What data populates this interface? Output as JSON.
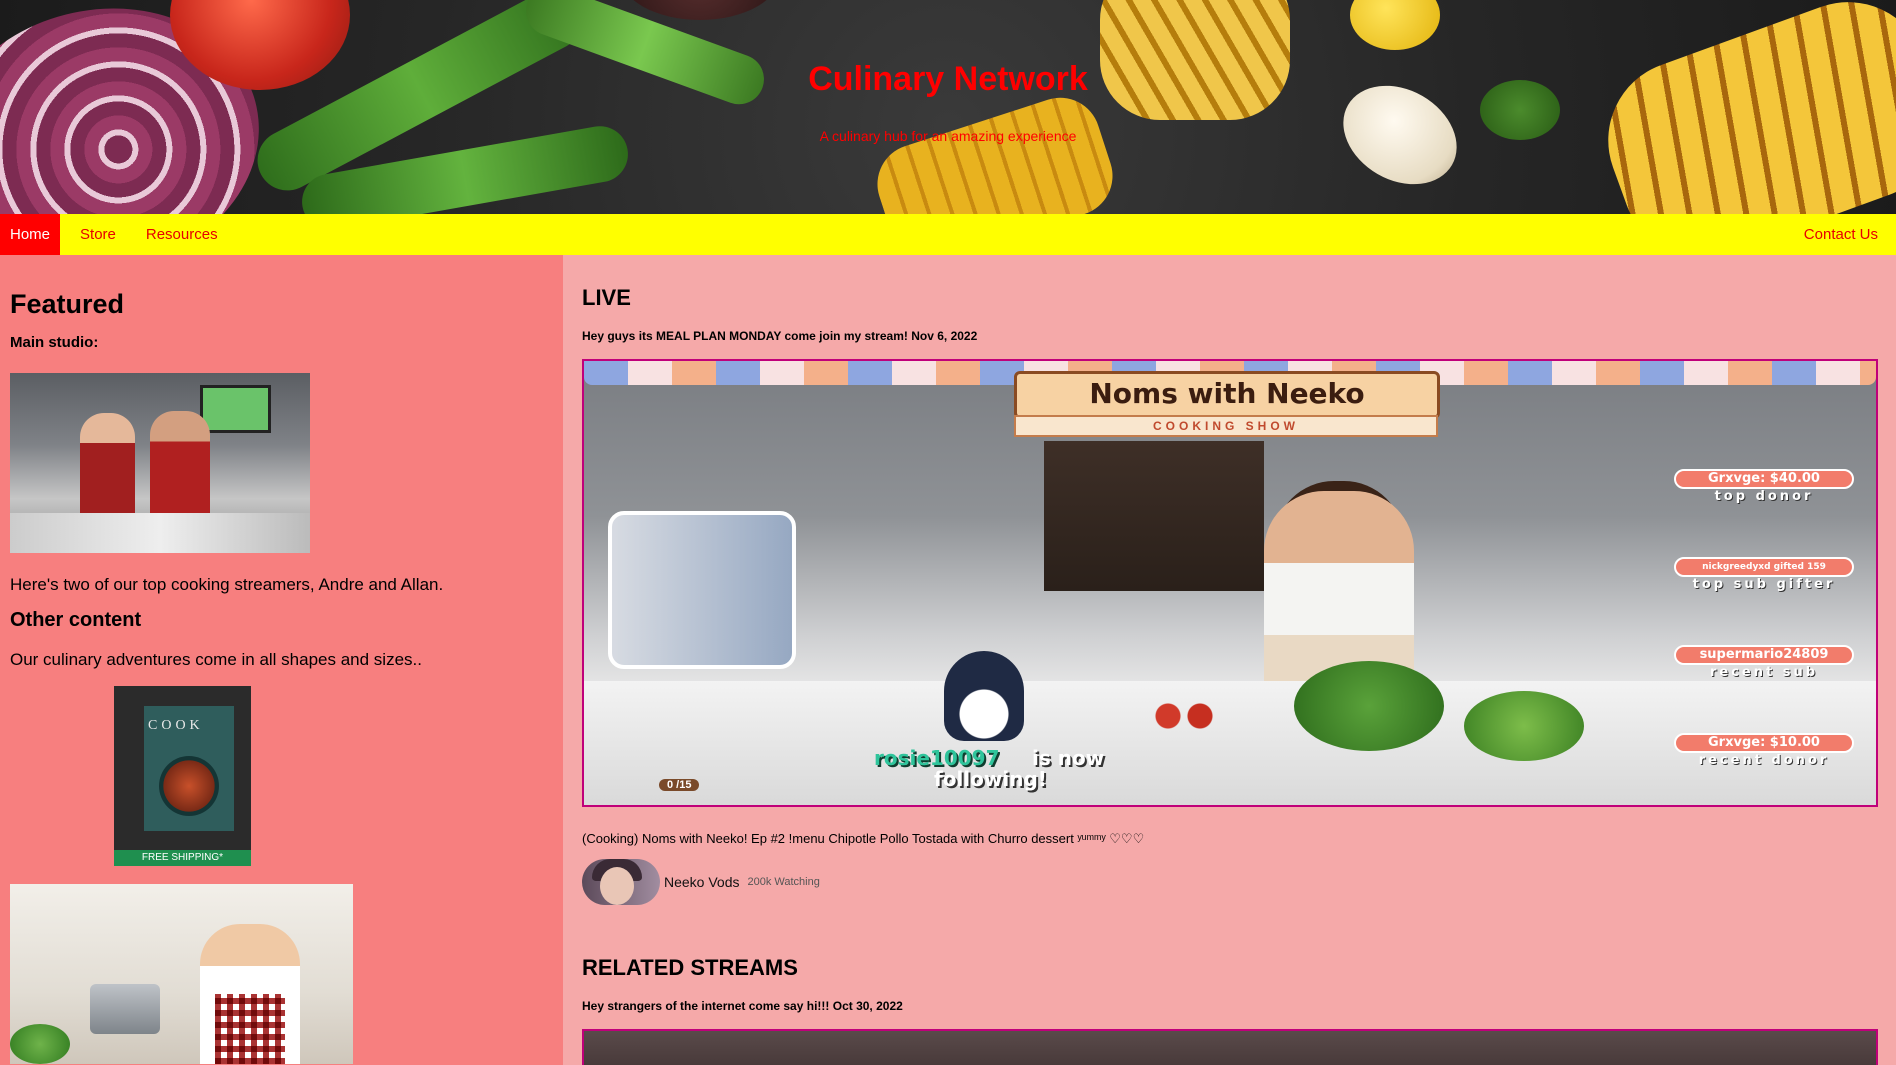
{
  "header": {
    "title": "Culinary Network",
    "tagline": "A culinary hub for an amazing experience"
  },
  "nav": {
    "home": "Home",
    "store": "Store",
    "resources": "Resources",
    "contact": "Contact Us"
  },
  "sidebar": {
    "featured_heading": "Featured",
    "studio_label": "Main studio:",
    "studio_desc": "Here's two of our top cooking streamers, Andre and Allan.",
    "other_heading": "Other content",
    "other_desc": "Our culinary adventures come in all shapes and sizes..",
    "book": {
      "cover_title": "COOK",
      "badge": "FREE SHIPPING*"
    }
  },
  "live": {
    "heading": "LIVE",
    "post_text": "Hey guys its MEAL PLAN MONDAY come join my stream!",
    "post_date": "Nov 6, 2022",
    "overlay": {
      "sign_title": "Noms with Neeko",
      "sign_subtitle": "COOKING SHOW",
      "follow_name": "rosie10097",
      "follow_text_1": "is now",
      "follow_text_2": "following!",
      "goal": "0 /15",
      "donors": [
        {
          "pill": "Grxvge: $40.00",
          "label": "top donor"
        },
        {
          "pill": "nickgreedyxd gifted 159",
          "label": "top sub gifter"
        },
        {
          "pill": "supermario24809",
          "label": "recent sub"
        },
        {
          "pill": "Grxvge: $10.00",
          "label": "recent donor"
        }
      ]
    },
    "stream_title": "(Cooking) Noms with Neeko! Ep #2 !menu Chipotle Pollo Tostada with Churro dessert ʸᵘᵐᵐʸ ♡♡♡",
    "streamer_name": "Neeko Vods",
    "watching": "200k Watching"
  },
  "related": {
    "heading": "RELATED STREAMS",
    "post_text": "Hey strangers of the internet come say hi!!!",
    "post_date": "Oct 30, 2022"
  },
  "colors": {
    "nav_bg": "#ffff00",
    "nav_active": "#ff0000",
    "left_bg": "#f77f7f",
    "right_bg": "#f5a9a9",
    "title": "#ff0000",
    "frame_border": "#c0007a"
  }
}
